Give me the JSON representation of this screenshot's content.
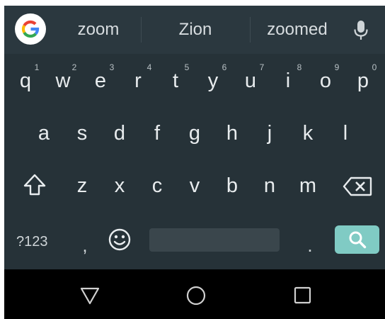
{
  "suggestions": [
    "zoom",
    "Zion",
    "zoomed"
  ],
  "rows": {
    "row1": [
      {
        "key": "q",
        "hint": "1"
      },
      {
        "key": "w",
        "hint": "2"
      },
      {
        "key": "e",
        "hint": "3"
      },
      {
        "key": "r",
        "hint": "4"
      },
      {
        "key": "t",
        "hint": "5"
      },
      {
        "key": "y",
        "hint": "6"
      },
      {
        "key": "u",
        "hint": "7"
      },
      {
        "key": "i",
        "hint": "8"
      },
      {
        "key": "o",
        "hint": "9"
      },
      {
        "key": "p",
        "hint": "0"
      }
    ],
    "row2": [
      "a",
      "s",
      "d",
      "f",
      "g",
      "h",
      "j",
      "k",
      "l"
    ],
    "row3": [
      "z",
      "x",
      "c",
      "v",
      "b",
      "n",
      "m"
    ]
  },
  "bottom_row": {
    "symbols_label": "?123",
    "comma": ",",
    "period": "."
  },
  "icons": {
    "google": "google-g-icon",
    "mic": "microphone-icon",
    "shift": "shift-icon",
    "delete": "backspace-icon",
    "emoji": "emoji-icon",
    "search": "search-icon",
    "nav_back": "back-triangle-icon",
    "nav_home": "home-circle-icon",
    "nav_recents": "recents-square-icon"
  },
  "colors": {
    "keyboard_bg": "#263238",
    "suggestion_bg": "#2b383f",
    "search_key": "#80cbc4",
    "navbar": "#000000"
  }
}
